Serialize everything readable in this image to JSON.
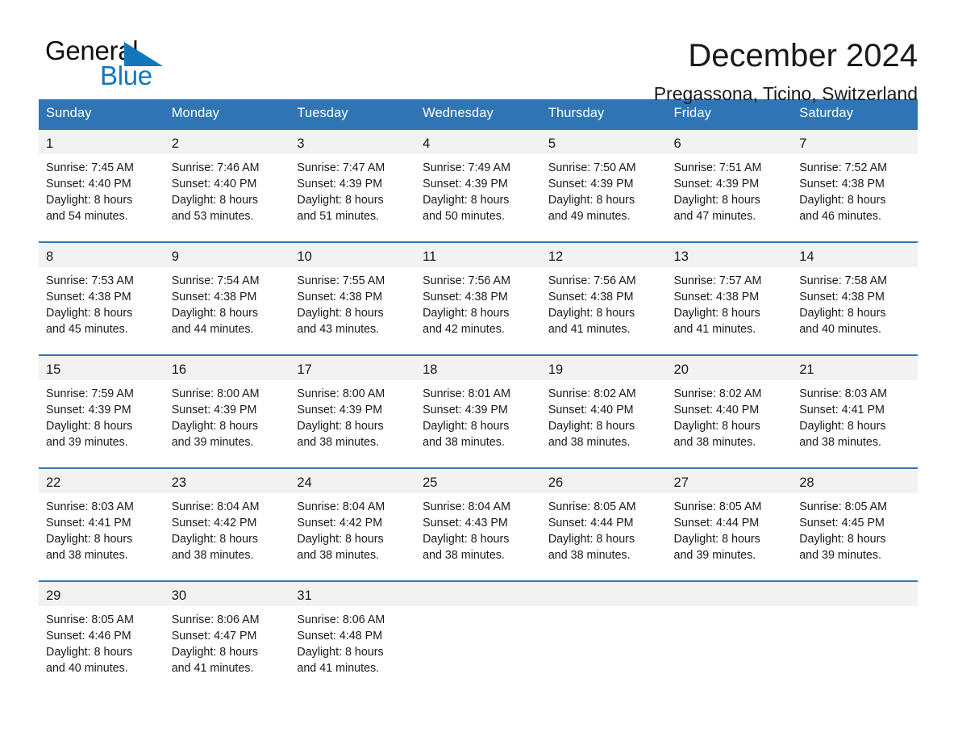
{
  "brand": {
    "name_part1": "General",
    "name_part2": "Blue",
    "accent_color": "#1277bc"
  },
  "header": {
    "title": "December 2024",
    "subtitle": "Pregassona, Ticino, Switzerland"
  },
  "theme": {
    "header_blue": "#2f75b5",
    "daynum_band": "#f2f2f2",
    "text": "#1a1a1a"
  },
  "weekday_headers": [
    "Sunday",
    "Monday",
    "Tuesday",
    "Wednesday",
    "Thursday",
    "Friday",
    "Saturday"
  ],
  "weeks": [
    [
      {
        "day": "1",
        "sunrise": "Sunrise: 7:45 AM",
        "sunset": "Sunset: 4:40 PM",
        "daylight_line1": "Daylight: 8 hours",
        "daylight_line2": "and 54 minutes."
      },
      {
        "day": "2",
        "sunrise": "Sunrise: 7:46 AM",
        "sunset": "Sunset: 4:40 PM",
        "daylight_line1": "Daylight: 8 hours",
        "daylight_line2": "and 53 minutes."
      },
      {
        "day": "3",
        "sunrise": "Sunrise: 7:47 AM",
        "sunset": "Sunset: 4:39 PM",
        "daylight_line1": "Daylight: 8 hours",
        "daylight_line2": "and 51 minutes."
      },
      {
        "day": "4",
        "sunrise": "Sunrise: 7:49 AM",
        "sunset": "Sunset: 4:39 PM",
        "daylight_line1": "Daylight: 8 hours",
        "daylight_line2": "and 50 minutes."
      },
      {
        "day": "5",
        "sunrise": "Sunrise: 7:50 AM",
        "sunset": "Sunset: 4:39 PM",
        "daylight_line1": "Daylight: 8 hours",
        "daylight_line2": "and 49 minutes."
      },
      {
        "day": "6",
        "sunrise": "Sunrise: 7:51 AM",
        "sunset": "Sunset: 4:39 PM",
        "daylight_line1": "Daylight: 8 hours",
        "daylight_line2": "and 47 minutes."
      },
      {
        "day": "7",
        "sunrise": "Sunrise: 7:52 AM",
        "sunset": "Sunset: 4:38 PM",
        "daylight_line1": "Daylight: 8 hours",
        "daylight_line2": "and 46 minutes."
      }
    ],
    [
      {
        "day": "8",
        "sunrise": "Sunrise: 7:53 AM",
        "sunset": "Sunset: 4:38 PM",
        "daylight_line1": "Daylight: 8 hours",
        "daylight_line2": "and 45 minutes."
      },
      {
        "day": "9",
        "sunrise": "Sunrise: 7:54 AM",
        "sunset": "Sunset: 4:38 PM",
        "daylight_line1": "Daylight: 8 hours",
        "daylight_line2": "and 44 minutes."
      },
      {
        "day": "10",
        "sunrise": "Sunrise: 7:55 AM",
        "sunset": "Sunset: 4:38 PM",
        "daylight_line1": "Daylight: 8 hours",
        "daylight_line2": "and 43 minutes."
      },
      {
        "day": "11",
        "sunrise": "Sunrise: 7:56 AM",
        "sunset": "Sunset: 4:38 PM",
        "daylight_line1": "Daylight: 8 hours",
        "daylight_line2": "and 42 minutes."
      },
      {
        "day": "12",
        "sunrise": "Sunrise: 7:56 AM",
        "sunset": "Sunset: 4:38 PM",
        "daylight_line1": "Daylight: 8 hours",
        "daylight_line2": "and 41 minutes."
      },
      {
        "day": "13",
        "sunrise": "Sunrise: 7:57 AM",
        "sunset": "Sunset: 4:38 PM",
        "daylight_line1": "Daylight: 8 hours",
        "daylight_line2": "and 41 minutes."
      },
      {
        "day": "14",
        "sunrise": "Sunrise: 7:58 AM",
        "sunset": "Sunset: 4:38 PM",
        "daylight_line1": "Daylight: 8 hours",
        "daylight_line2": "and 40 minutes."
      }
    ],
    [
      {
        "day": "15",
        "sunrise": "Sunrise: 7:59 AM",
        "sunset": "Sunset: 4:39 PM",
        "daylight_line1": "Daylight: 8 hours",
        "daylight_line2": "and 39 minutes."
      },
      {
        "day": "16",
        "sunrise": "Sunrise: 8:00 AM",
        "sunset": "Sunset: 4:39 PM",
        "daylight_line1": "Daylight: 8 hours",
        "daylight_line2": "and 39 minutes."
      },
      {
        "day": "17",
        "sunrise": "Sunrise: 8:00 AM",
        "sunset": "Sunset: 4:39 PM",
        "daylight_line1": "Daylight: 8 hours",
        "daylight_line2": "and 38 minutes."
      },
      {
        "day": "18",
        "sunrise": "Sunrise: 8:01 AM",
        "sunset": "Sunset: 4:39 PM",
        "daylight_line1": "Daylight: 8 hours",
        "daylight_line2": "and 38 minutes."
      },
      {
        "day": "19",
        "sunrise": "Sunrise: 8:02 AM",
        "sunset": "Sunset: 4:40 PM",
        "daylight_line1": "Daylight: 8 hours",
        "daylight_line2": "and 38 minutes."
      },
      {
        "day": "20",
        "sunrise": "Sunrise: 8:02 AM",
        "sunset": "Sunset: 4:40 PM",
        "daylight_line1": "Daylight: 8 hours",
        "daylight_line2": "and 38 minutes."
      },
      {
        "day": "21",
        "sunrise": "Sunrise: 8:03 AM",
        "sunset": "Sunset: 4:41 PM",
        "daylight_line1": "Daylight: 8 hours",
        "daylight_line2": "and 38 minutes."
      }
    ],
    [
      {
        "day": "22",
        "sunrise": "Sunrise: 8:03 AM",
        "sunset": "Sunset: 4:41 PM",
        "daylight_line1": "Daylight: 8 hours",
        "daylight_line2": "and 38 minutes."
      },
      {
        "day": "23",
        "sunrise": "Sunrise: 8:04 AM",
        "sunset": "Sunset: 4:42 PM",
        "daylight_line1": "Daylight: 8 hours",
        "daylight_line2": "and 38 minutes."
      },
      {
        "day": "24",
        "sunrise": "Sunrise: 8:04 AM",
        "sunset": "Sunset: 4:42 PM",
        "daylight_line1": "Daylight: 8 hours",
        "daylight_line2": "and 38 minutes."
      },
      {
        "day": "25",
        "sunrise": "Sunrise: 8:04 AM",
        "sunset": "Sunset: 4:43 PM",
        "daylight_line1": "Daylight: 8 hours",
        "daylight_line2": "and 38 minutes."
      },
      {
        "day": "26",
        "sunrise": "Sunrise: 8:05 AM",
        "sunset": "Sunset: 4:44 PM",
        "daylight_line1": "Daylight: 8 hours",
        "daylight_line2": "and 38 minutes."
      },
      {
        "day": "27",
        "sunrise": "Sunrise: 8:05 AM",
        "sunset": "Sunset: 4:44 PM",
        "daylight_line1": "Daylight: 8 hours",
        "daylight_line2": "and 39 minutes."
      },
      {
        "day": "28",
        "sunrise": "Sunrise: 8:05 AM",
        "sunset": "Sunset: 4:45 PM",
        "daylight_line1": "Daylight: 8 hours",
        "daylight_line2": "and 39 minutes."
      }
    ],
    [
      {
        "day": "29",
        "sunrise": "Sunrise: 8:05 AM",
        "sunset": "Sunset: 4:46 PM",
        "daylight_line1": "Daylight: 8 hours",
        "daylight_line2": "and 40 minutes."
      },
      {
        "day": "30",
        "sunrise": "Sunrise: 8:06 AM",
        "sunset": "Sunset: 4:47 PM",
        "daylight_line1": "Daylight: 8 hours",
        "daylight_line2": "and 41 minutes."
      },
      {
        "day": "31",
        "sunrise": "Sunrise: 8:06 AM",
        "sunset": "Sunset: 4:48 PM",
        "daylight_line1": "Daylight: 8 hours",
        "daylight_line2": "and 41 minutes."
      },
      {
        "day": "",
        "sunrise": "",
        "sunset": "",
        "daylight_line1": "",
        "daylight_line2": ""
      },
      {
        "day": "",
        "sunrise": "",
        "sunset": "",
        "daylight_line1": "",
        "daylight_line2": ""
      },
      {
        "day": "",
        "sunrise": "",
        "sunset": "",
        "daylight_line1": "",
        "daylight_line2": ""
      },
      {
        "day": "",
        "sunrise": "",
        "sunset": "",
        "daylight_line1": "",
        "daylight_line2": ""
      }
    ]
  ]
}
